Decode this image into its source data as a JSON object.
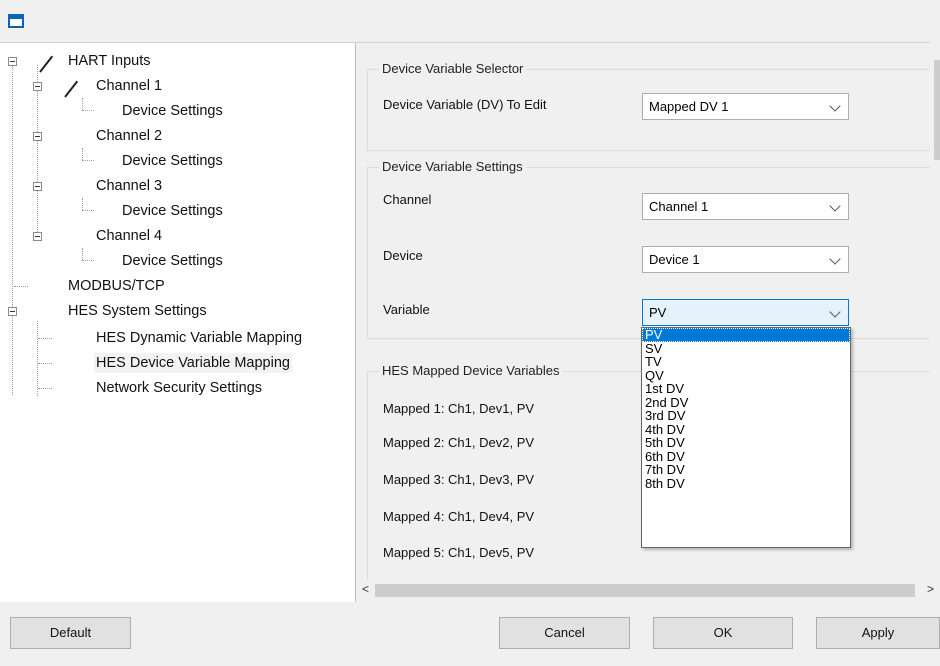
{
  "tree": {
    "hart_inputs": "HART Inputs",
    "channels": [
      {
        "label": "Channel 1",
        "child": "Device Settings"
      },
      {
        "label": "Channel 2",
        "child": "Device Settings"
      },
      {
        "label": "Channel 3",
        "child": "Device Settings"
      },
      {
        "label": "Channel 4",
        "child": "Device Settings"
      }
    ],
    "modbus": "MODBUS/TCP",
    "hes_system": "HES System Settings",
    "hes_children": [
      "HES Dynamic Variable Mapping",
      "HES Device Variable Mapping",
      "Network Security Settings"
    ]
  },
  "selector_group": {
    "title": "Device Variable Selector",
    "dv_label": "Device Variable  (DV) To Edit",
    "dv_value": "Mapped DV 1"
  },
  "settings_group": {
    "title": "Device Variable Settings",
    "channel_label": "Channel",
    "channel_value": "Channel 1",
    "device_label": "Device",
    "device_value": "Device 1",
    "variable_label": "Variable",
    "variable_value": "PV"
  },
  "variable_options": [
    "PV",
    "SV",
    "TV",
    "QV",
    "1st DV",
    "2nd DV",
    "3rd DV",
    "4th DV",
    "5th DV",
    "6th DV",
    "7th DV",
    "8th DV"
  ],
  "mapped_group": {
    "title": "HES Mapped Device Variables",
    "items": [
      "Mapped 1: Ch1, Dev1, PV",
      "Mapped 2: Ch1, Dev2, PV",
      "Mapped 3: Ch1, Dev3, PV",
      "Mapped 4: Ch1, Dev4, PV",
      "Mapped 5: Ch1, Dev5, PV"
    ]
  },
  "buttons": {
    "default": "Default",
    "cancel": "Cancel",
    "ok": "OK",
    "apply": "Apply"
  },
  "scroll": {
    "left_arrow": "<",
    "right_arrow": ">"
  },
  "colors": {
    "accent": "#0078d7",
    "selection": "#0078d7"
  }
}
